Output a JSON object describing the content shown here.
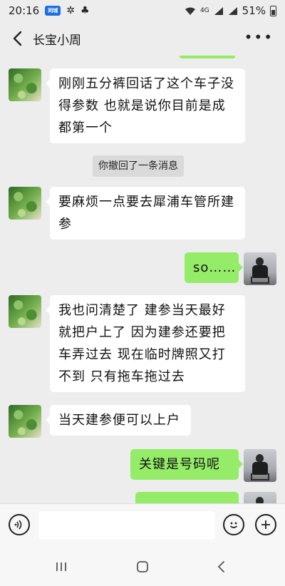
{
  "status_bar": {
    "time": "20:16",
    "app_badge": "同城分享",
    "network": "4G",
    "battery": "51%"
  },
  "header": {
    "back_icon": "chevron-left-icon",
    "title": "长宝小周",
    "more_icon": "more-dots-icon"
  },
  "messages": [
    {
      "from": "friend",
      "text": "刚刚五分裤回话了这个车子没得参数 也就是说你目前是成都第一个"
    },
    {
      "type": "system",
      "text": "你撤回了一条消息"
    },
    {
      "from": "friend",
      "text": "要麻烦一点要去犀浦车管所建参"
    },
    {
      "from": "me",
      "text": "so……"
    },
    {
      "from": "friend",
      "text": "我也问清楚了 建参当天最好就把户上了 因为建参还要把车弄过去 现在临时牌照又打不到 只有拖车拖过去"
    },
    {
      "from": "friend",
      "text": "当天建参便可以上户"
    },
    {
      "from": "me",
      "text": "关键是号码呢"
    }
  ],
  "input_bar": {
    "voice_icon": "voice-icon",
    "input_value": "",
    "emoji_icon": "emoji-icon",
    "plus_icon": "plus-icon"
  },
  "nav_bar": {
    "recents_icon": "recents-icon",
    "home_icon": "home-icon",
    "back_icon": "back-icon"
  },
  "colors": {
    "background": "#ededed",
    "bubble_me": "#95ec69",
    "bubble_friend": "#ffffff",
    "system_notice": "#dadada"
  }
}
